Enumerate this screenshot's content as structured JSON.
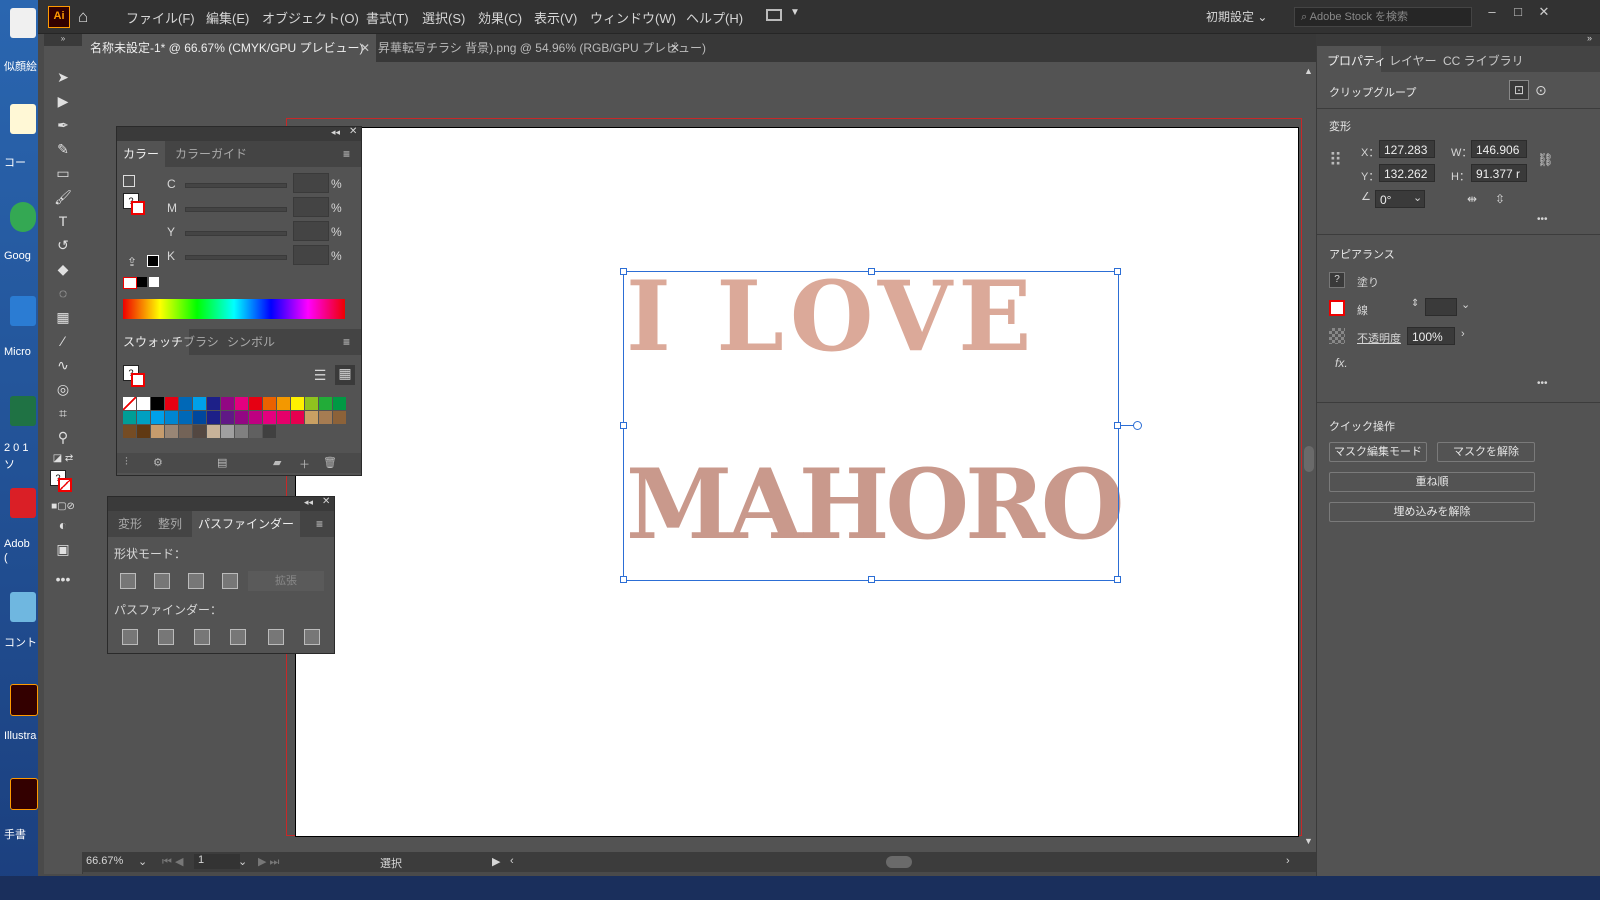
{
  "app": {
    "logo_text": "Ai",
    "menu": [
      "ファイル(F)",
      "編集(E)",
      "オブジェクト(O)",
      "書式(T)",
      "選択(S)",
      "効果(C)",
      "表示(V)",
      "ウィンドウ(W)",
      "ヘルプ(H)"
    ],
    "workspace": "初期設定",
    "stock_placeholder": "Adobe Stock を検索",
    "window_buttons": [
      "–",
      "□",
      "✕"
    ]
  },
  "tabs": [
    {
      "label": "名称未設定-1* @ 66.67% (CMYK/GPU プレビュー)",
      "active": true
    },
    {
      "label": "昇華転写チラシ 背景).png @ 54.96% (RGB/GPU プレビュー)",
      "active": false
    }
  ],
  "desktop": {
    "labels": [
      "似顔絵",
      "コー",
      "Goog",
      "Micro",
      "2 0 1",
      "ソ",
      "Adob",
      "(",
      "コントロ",
      "Illustra",
      "手書"
    ]
  },
  "artwork": {
    "line1": "I LOVE",
    "line2": "MAHORO"
  },
  "color_panel": {
    "tabs": [
      "カラー",
      "カラーガイド"
    ],
    "channels": [
      "C",
      "M",
      "Y",
      "K"
    ],
    "unit": "%",
    "unknown": "?"
  },
  "swatch_panel": {
    "tabs": [
      "スウォッチ",
      "ブラシ",
      "シンボル"
    ],
    "colors": [
      "#ffffff",
      "#000000",
      "#e60012",
      "#0068b7",
      "#00a0e9",
      "#1d2088",
      "#920783",
      "#e4007f",
      "#e60012",
      "#eb6100",
      "#f39800",
      "#fff100",
      "#8fc31f",
      "#22ac38",
      "#009944",
      "#009e96",
      "#00a0c1",
      "#00a0e9",
      "#0086d1",
      "#0068b7",
      "#00479d",
      "#1d2088",
      "#601986",
      "#920783",
      "#be0081",
      "#e4007f",
      "#e5006a",
      "#e5004f",
      "#c9a063",
      "#a67c52",
      "#8c6239",
      "#754c24",
      "#603913",
      "#c69c6d",
      "#998675",
      "#736357",
      "#534741",
      "#c7b299",
      "#a0a0a0",
      "#808080",
      "#606060",
      "#404040"
    ]
  },
  "pathfinder_panel": {
    "tabs": [
      "変形",
      "整列",
      "パスファインダー"
    ],
    "shape_modes_label": "形状モード：",
    "expand_label": "拡張",
    "pathfinders_label": "パスファインダー："
  },
  "properties": {
    "tabs": [
      "プロパティ",
      "レイヤー",
      "CC ライブラリ"
    ],
    "selection_type": "クリップグループ",
    "transform": {
      "heading": "変形",
      "x_label": "X：",
      "x": "127.283",
      "y_label": "Y：",
      "y": "132.262",
      "w_label": "W：",
      "w": "146.906",
      "h_label": "H：",
      "h": "91.377 r",
      "angle": "0°"
    },
    "appearance": {
      "heading": "アピアランス",
      "fill_label": "塗り",
      "stroke_label": "線",
      "opacity_label": "不透明度",
      "opacity": "100%",
      "fx": "fx."
    },
    "quick_actions": {
      "heading": "クイック操作",
      "buttons": [
        "マスク編集モード",
        "マスクを解除",
        "重ね順",
        "埋め込みを解除"
      ]
    },
    "more": "•••"
  },
  "status": {
    "zoom": "66.67%",
    "artboard": "1",
    "tool": "選択"
  }
}
